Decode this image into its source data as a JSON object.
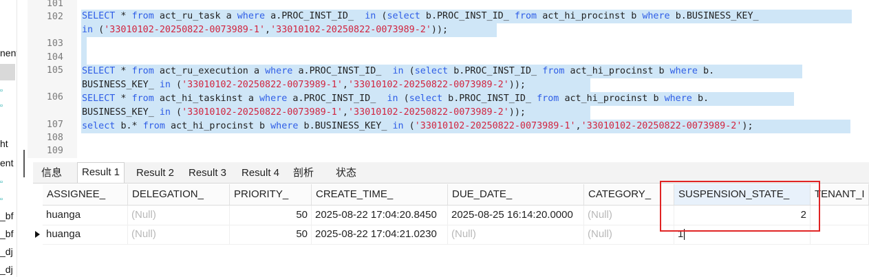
{
  "sidebar": {
    "labels": [
      "nent",
      "ht",
      "ent",
      "_bf",
      "_bf",
      "_dj",
      "_dj"
    ]
  },
  "editor": {
    "line_numbers": [
      "101",
      "102",
      "",
      "103",
      "104",
      "105",
      "",
      "106",
      "",
      "107",
      "108",
      "109"
    ],
    "lines": {
      "l102a": [
        "SELECT * from act_ru_task a where a.PROC_INST_ID_  in (select b.PROC_INST_ID_ from act_hi_procinst b where b.BUSINESS_KEY_"
      ],
      "l102b": "in ('33010102-20250822-0073989-1','33010102-20250822-0073989-2'));",
      "l105a": "SELECT * from act_ru_execution a where a.PROC_INST_ID_  in (select b.PROC_INST_ID_ from act_hi_procinst b where b.",
      "l105b": "BUSINESS_KEY_ in ('33010102-20250822-0073989-1','33010102-20250822-0073989-2'));",
      "l106a": "SELECT * from act_hi_taskinst a where a.PROC_INST_ID_  in (select b.PROC_INST_ID_ from act_hi_procinst b where b.",
      "l106b": "BUSINESS_KEY_ in ('33010102-20250822-0073989-1','33010102-20250822-0073989-2'));",
      "l107": "select b.* from act_hi_procinst b where b.BUSINESS_KEY_ in ('33010102-20250822-0073989-1','33010102-20250822-0073989-2');"
    }
  },
  "tabs": [
    "信息",
    "Result 1",
    "Result 2",
    "Result 3",
    "Result 4",
    "剖析",
    "状态"
  ],
  "active_tab": "Result 1",
  "grid": {
    "columns": [
      "ASSIGNEE_",
      "DELEGATION_",
      "PRIORITY_",
      "CREATE_TIME_",
      "DUE_DATE_",
      "CATEGORY_",
      "SUSPENSION_STATE_",
      "TENANT_I"
    ],
    "rows": [
      [
        "huanga",
        "(Null)",
        "50",
        "2025-08-22 17:04:20.8450",
        "2025-08-25 16:14:20.0000",
        "(Null)",
        "2",
        ""
      ],
      [
        "huanga",
        "(Null)",
        "50",
        "2025-08-22 17:04:21.0230",
        "(Null)",
        "(Null)",
        "1",
        ""
      ]
    ]
  },
  "colors": {
    "highlight": "#cfe6f7",
    "keyword": "#2e5de6",
    "string": "#d1243f",
    "annotation_box": "#e02323"
  }
}
